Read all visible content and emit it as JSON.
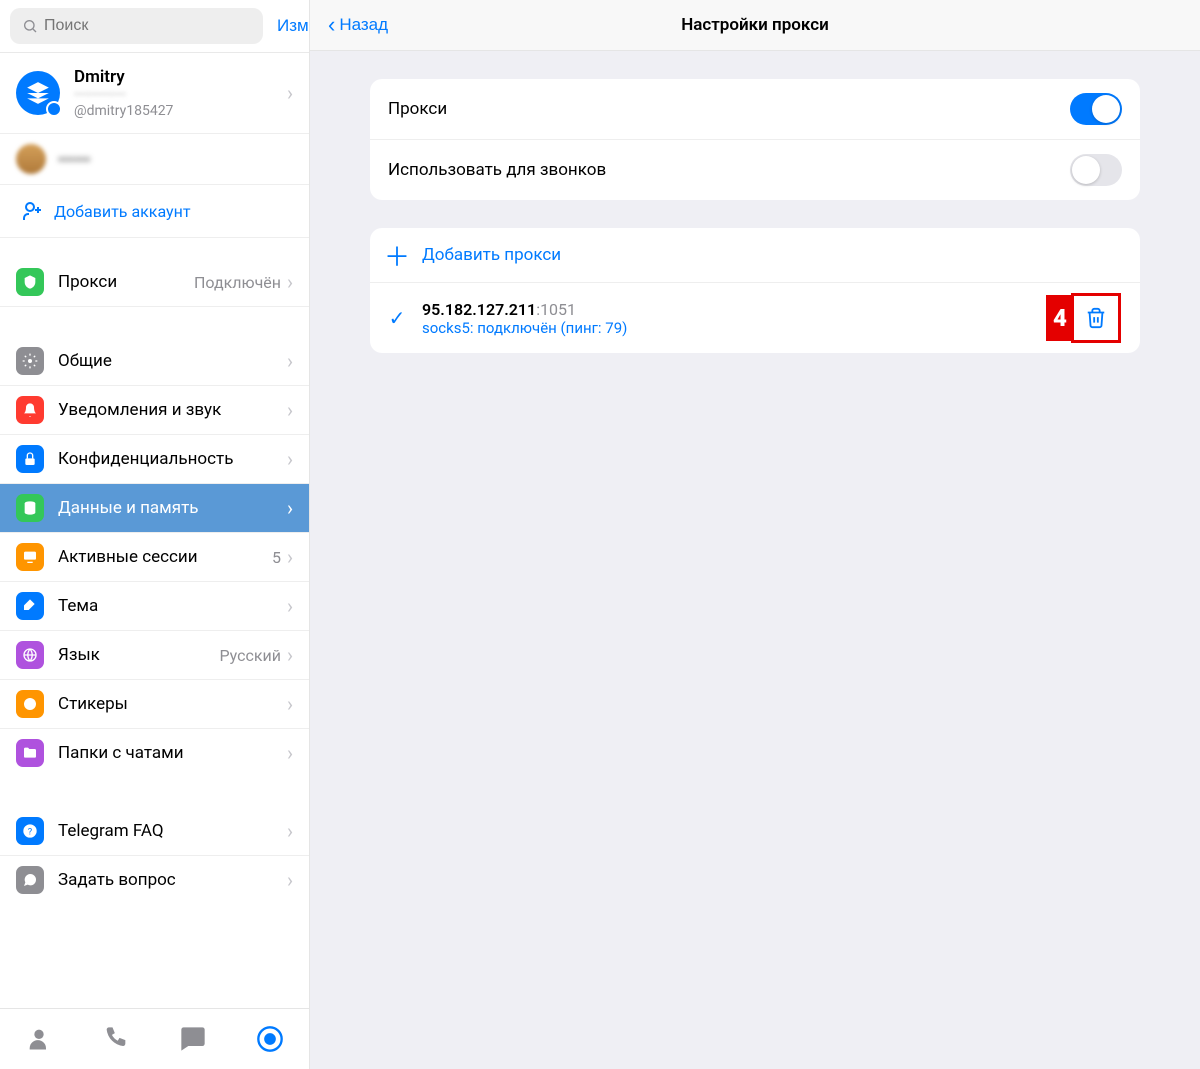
{
  "sidebar": {
    "search_placeholder": "Поиск",
    "edit_label": "Изм.",
    "profile": {
      "name": "Dmitry",
      "handle": "@dmitry185427"
    },
    "add_account_label": "Добавить аккаунт",
    "menu_proxy": {
      "label": "Прокси",
      "value": "Подключён"
    },
    "menu": [
      {
        "id": "general",
        "label": "Общие",
        "icon_bg": "#8e8e93"
      },
      {
        "id": "notif",
        "label": "Уведомления и звук",
        "icon_bg": "#ff3b30"
      },
      {
        "id": "privacy",
        "label": "Конфиденциальность",
        "icon_bg": "#007aff"
      },
      {
        "id": "data",
        "label": "Данные и память",
        "icon_bg": "#34c759",
        "selected": true
      },
      {
        "id": "sessions",
        "label": "Активные сессии",
        "icon_bg": "#ff9500",
        "value": "5"
      },
      {
        "id": "theme",
        "label": "Тема",
        "icon_bg": "#007aff"
      },
      {
        "id": "lang",
        "label": "Язык",
        "icon_bg": "#af52de",
        "value": "Русский"
      },
      {
        "id": "stickers",
        "label": "Стикеры",
        "icon_bg": "#ff9500"
      },
      {
        "id": "folders",
        "label": "Папки с чатами",
        "icon_bg": "#af52de"
      }
    ],
    "menu_faq": {
      "label": "Telegram FAQ"
    },
    "menu_support": {
      "label": "Задать вопрос"
    }
  },
  "header": {
    "back_label": "Назад",
    "title": "Настройки прокси"
  },
  "settings": {
    "proxy_toggle_label": "Прокси",
    "calls_toggle_label": "Использовать для звонков",
    "add_proxy_label": "Добавить прокси",
    "proxy_entry": {
      "ip": "95.182.127.211",
      "port": ":1051",
      "status": "socks5: подключён (пинг: 79)"
    },
    "annotation_badge": "4"
  }
}
